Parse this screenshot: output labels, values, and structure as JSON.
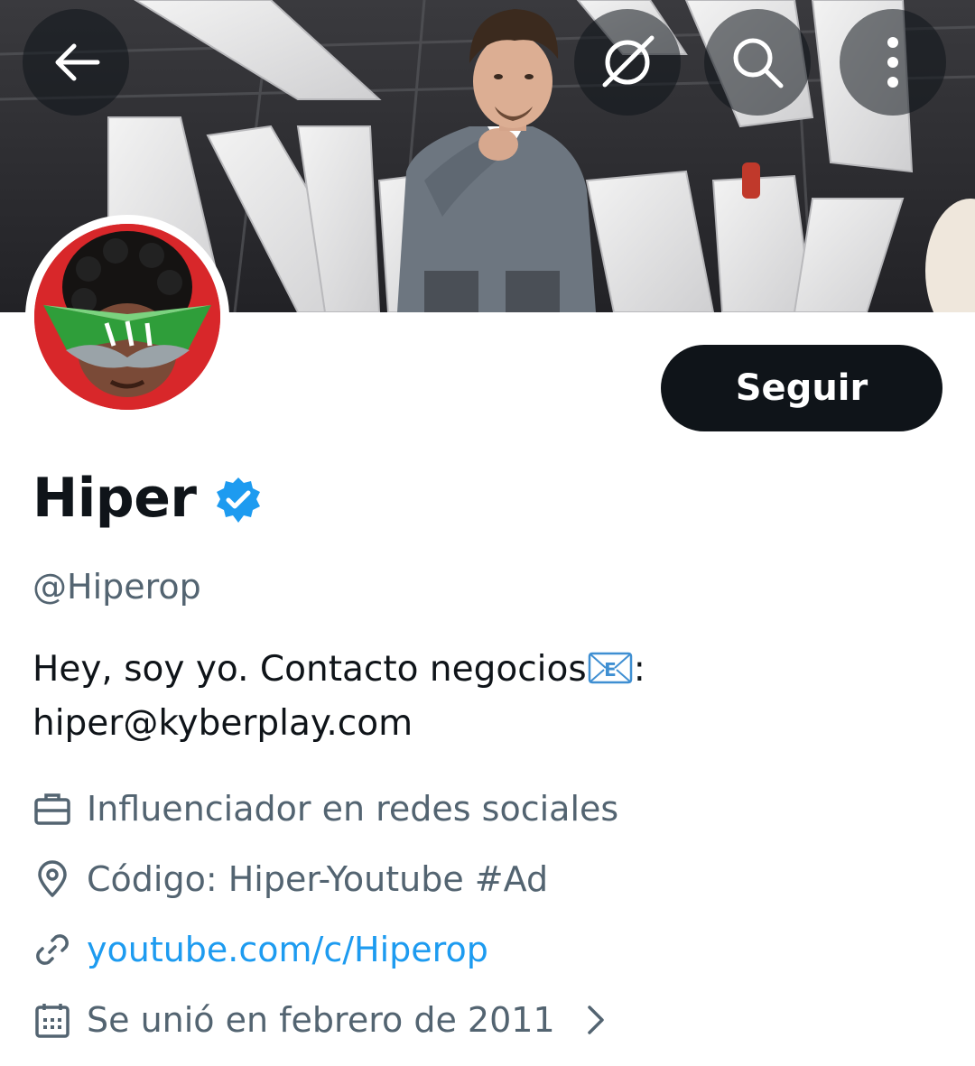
{
  "header": {
    "back_icon": "arrow-left-icon",
    "grok_icon": "grok-icon",
    "search_icon": "search-icon",
    "more_icon": "more-vertical-icon"
  },
  "profile": {
    "display_name": "Hiper",
    "verified": true,
    "verified_color": "#1d9bf0",
    "handle": "@Hiperop",
    "follow_label": "Seguir",
    "bio_line1": "Hey, soy yo. Contacto negocios",
    "bio_line1_suffix": ":",
    "bio_line2": "hiper@kyberplay.com",
    "meta": {
      "category": "Influenciador en redes sociales",
      "location": "Código: Hiper-Youtube #Ad",
      "website": "youtube.com/c/Hiperop",
      "joined": "Se unió en febrero de 2011"
    }
  },
  "colors": {
    "text_primary": "#0f1419",
    "text_secondary": "#536471",
    "link": "#1d9bf0",
    "button_bg": "#0f1419",
    "avatar_bg": "#d8272a"
  }
}
